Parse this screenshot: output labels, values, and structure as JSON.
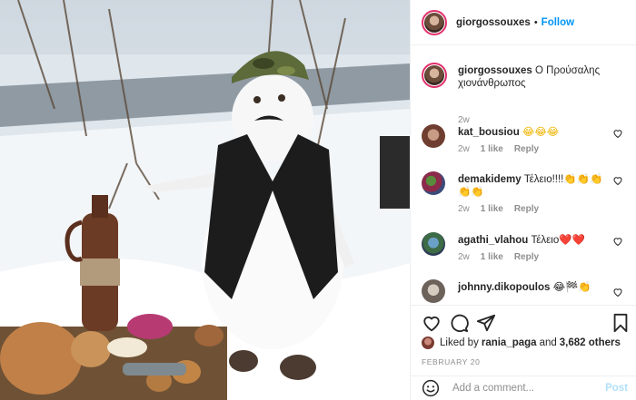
{
  "post": {
    "username": "giorgossouxes",
    "follow_label": "Follow",
    "separator": "•",
    "caption_user": "giorgossouxes",
    "caption_text": " Ο Προύσαλης χιονάνθρωπος",
    "caption_age": "2w"
  },
  "comments": [
    {
      "user": "kat_bousiou",
      "text": " 😂😂😂",
      "age": "2w",
      "likes": "1 like",
      "reply": "Reply"
    },
    {
      "user": "demakidemy",
      "text": " Τέλειο!!!!👏👏👏👏👏",
      "age": "2w",
      "likes": "1 like",
      "reply": "Reply"
    },
    {
      "user": "agathi_vlahou",
      "text": " Τέλειο❤️❤️",
      "age": "2w",
      "likes": "1 like",
      "reply": "Reply"
    },
    {
      "user": "johnny.dikopoulos",
      "text": " 😂🏁👏"
    }
  ],
  "likes": {
    "prefix": "Liked by",
    "user": "rania_paga",
    "connector": "and",
    "others": "3,682 others"
  },
  "date": "FEBRUARY 20",
  "comment_input": {
    "placeholder": "Add a comment..."
  },
  "post_button": "Post",
  "colors": {
    "accent": "#0095f6",
    "heart": "#e0245e",
    "muted": "#8e8e8e"
  },
  "icons": [
    "heart-icon",
    "comment-icon",
    "share-icon",
    "bookmark-icon",
    "emoji-icon"
  ]
}
